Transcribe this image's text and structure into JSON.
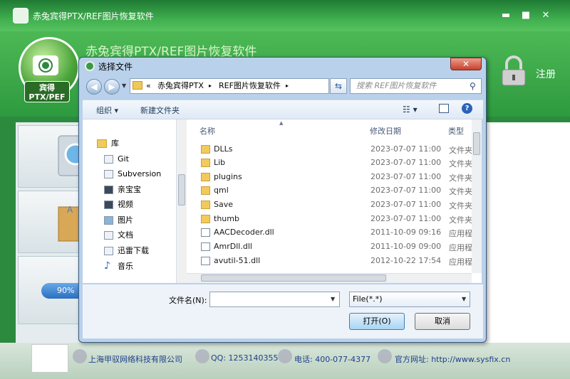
{
  "app": {
    "title": "赤兔宾得PTX/REF图片恢复软件",
    "brand": "赤兔宾得PTX/REF图片恢复软件",
    "logo_text": "宾得\nPTX/PEF",
    "register_label": "注册",
    "progress_text": "90%",
    "window_controls": {
      "minimize": "▬",
      "maximize": "■",
      "close": "✕"
    }
  },
  "footer": {
    "company": "上海甲驭网络科技有限公司",
    "qq": "QQ: 1253140355",
    "phone": "电话: 400-077-4377",
    "website": "官方网址: http://www.sysfix.cn"
  },
  "dialog": {
    "title": "选择文件",
    "close_label": "✕",
    "breadcrumb": [
      "«",
      "赤兔宾得PTX",
      "▸",
      "REF图片恢复软件",
      "▸"
    ],
    "search_placeholder": "搜索 REF图片恢复软件",
    "toolbar": {
      "organize": "组织 ▾",
      "new_folder": "新建文件夹"
    },
    "tree": [
      {
        "label": "库",
        "icon": "library-icon"
      },
      {
        "label": "Git",
        "icon": "doc-icon"
      },
      {
        "label": "Subversion",
        "icon": "doc-icon"
      },
      {
        "label": "亲宝宝",
        "icon": "video-icon"
      },
      {
        "label": "视频",
        "icon": "video-icon"
      },
      {
        "label": "图片",
        "icon": "picture-icon"
      },
      {
        "label": "文档",
        "icon": "doc-icon"
      },
      {
        "label": "迅雷下载",
        "icon": "doc-icon"
      },
      {
        "label": "音乐",
        "icon": "music-icon"
      }
    ],
    "columns": {
      "name": "名称",
      "modified": "修改日期",
      "type": "类型"
    },
    "files": [
      {
        "name": "DLLs",
        "date": "2023-07-07 11:00",
        "type": "文件夹",
        "kind": "folder"
      },
      {
        "name": "Lib",
        "date": "2023-07-07 11:00",
        "type": "文件夹",
        "kind": "folder"
      },
      {
        "name": "plugins",
        "date": "2023-07-07 11:00",
        "type": "文件夹",
        "kind": "folder"
      },
      {
        "name": "qml",
        "date": "2023-07-07 11:00",
        "type": "文件夹",
        "kind": "folder"
      },
      {
        "name": "Save",
        "date": "2023-07-07 11:00",
        "type": "文件夹",
        "kind": "folder"
      },
      {
        "name": "thumb",
        "date": "2023-07-07 11:00",
        "type": "文件夹",
        "kind": "folder"
      },
      {
        "name": "AACDecoder.dll",
        "date": "2011-10-09 09:16",
        "type": "应用程序",
        "kind": "dll"
      },
      {
        "name": "AmrDll.dll",
        "date": "2011-10-09 09:00",
        "type": "应用程序",
        "kind": "dll"
      },
      {
        "name": "avutil-51.dll",
        "date": "2012-10-22 17:54",
        "type": "应用程序",
        "kind": "dll"
      }
    ],
    "filename_label": "文件名(N):",
    "filename_value": "",
    "filter_value": "File(*.*)",
    "open_label": "打开(O)",
    "cancel_label": "取消"
  }
}
